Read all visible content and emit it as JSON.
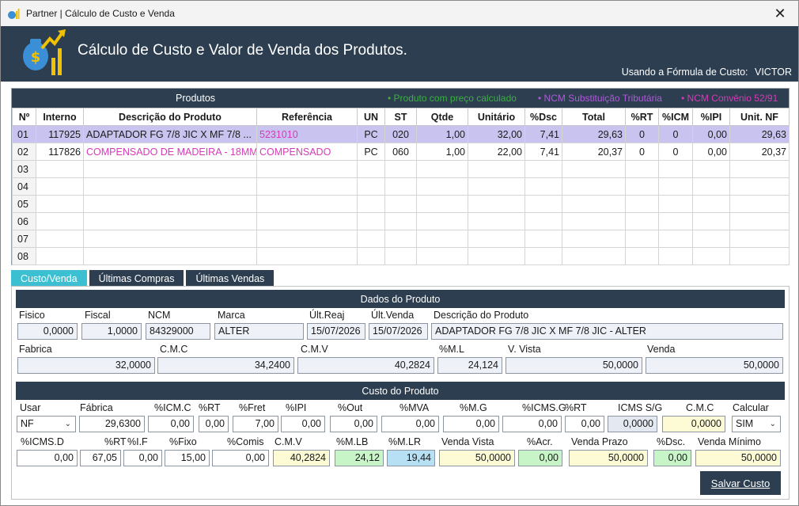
{
  "window": {
    "title": "Partner | Cálculo de Custo e Venda",
    "close": "✕"
  },
  "header": {
    "title": "Cálculo de Custo e Valor de Venda dos Produtos.",
    "formula_label": "Usando a Fórmula de Custo:",
    "formula_value": "VICTOR"
  },
  "products": {
    "label": "Produtos",
    "legend": [
      {
        "text": "• Produto com preço calculado",
        "color": "#3cb043"
      },
      {
        "text": "• NCM Substituição Tributária",
        "color": "#b05ad8"
      },
      {
        "text": "• NCM Convênio 52/91",
        "color": "#d63bb7"
      }
    ],
    "columns": [
      "Nº",
      "Interno",
      "Descrição do Produto",
      "Referência",
      "UN",
      "ST",
      "Qtde",
      "Unitário",
      "%Dsc",
      "Total",
      "%RT",
      "%ICM",
      "%IPI",
      "Unit. NF"
    ],
    "rows": [
      [
        "01",
        "117925",
        "ADAPTADOR FG 7/8 JIC X MF 7/8 ...",
        "5231010",
        "PC",
        "020",
        "1,00",
        "32,00",
        "7,41",
        "29,63",
        "0",
        "0",
        "0,00",
        "29,63"
      ],
      [
        "02",
        "117826",
        "COMPENSADO DE MADEIRA - 18MM",
        "COMPENSADO",
        "PC",
        "060",
        "1,00",
        "22,00",
        "7,41",
        "20,37",
        "0",
        "0",
        "0,00",
        "20,37"
      ],
      [
        "03",
        "",
        "",
        "",
        "",
        "",
        "",
        "",
        "",
        "",
        "",
        "",
        "",
        ""
      ],
      [
        "04",
        "",
        "",
        "",
        "",
        "",
        "",
        "",
        "",
        "",
        "",
        "",
        "",
        ""
      ],
      [
        "05",
        "",
        "",
        "",
        "",
        "",
        "",
        "",
        "",
        "",
        "",
        "",
        "",
        ""
      ],
      [
        "06",
        "",
        "",
        "",
        "",
        "",
        "",
        "",
        "",
        "",
        "",
        "",
        "",
        ""
      ],
      [
        "07",
        "",
        "",
        "",
        "",
        "",
        "",
        "",
        "",
        "",
        "",
        "",
        "",
        ""
      ],
      [
        "08",
        "",
        "",
        "",
        "",
        "",
        "",
        "",
        "",
        "",
        "",
        "",
        "",
        ""
      ]
    ]
  },
  "tabs": [
    "Custo/Venda",
    "Últimas Compras",
    "Últimas Vendas"
  ],
  "dados": {
    "title": "Dados do Produto",
    "labels": {
      "fisico": "Fisico",
      "fiscal": "Fiscal",
      "ncm": "NCM",
      "marca": "Marca",
      "ult_reaj": "Últ.Reaj",
      "ult_venda": "Últ.Venda",
      "descricao": "Descrição do Produto",
      "fabrica": "Fabrica",
      "cmc": "C.M.C",
      "cmv": "C.M.V",
      "ml": "%M.L",
      "vista": "V. Vista",
      "venda": "Venda"
    },
    "values": {
      "fisico": "0,0000",
      "fiscal": "1,0000",
      "ncm": "84329000",
      "marca": "ALTER",
      "ult_reaj": "15/07/2026",
      "ult_venda": "15/07/2026",
      "descricao": "ADAPTADOR FG 7/8 JIC X MF 7/8 JIC - ALTER",
      "fabrica": "32,0000",
      "cmc": "34,2400",
      "cmv": "40,2824",
      "ml": "24,124",
      "vista": "50,0000",
      "venda": "50,0000"
    }
  },
  "custo": {
    "title": "Custo do Produto",
    "row1_labels": [
      "Usar",
      "Fábrica",
      "%ICM.C",
      "%RT",
      "%Fret",
      "%IPI",
      "%Out",
      "%MVA",
      "%M.G",
      "%ICMS.G",
      "%RT",
      "ICMS S/G",
      "C.M.C",
      "Calcular"
    ],
    "row1_values": [
      "NF",
      "29,6300",
      "0,00",
      "0,00",
      "7,00",
      "0,00",
      "0,00",
      "0,00",
      "0,00",
      "0,00",
      "0,00",
      "0,0000",
      "0,0000",
      "SIM"
    ],
    "row2_labels": [
      "%ICMS.D",
      "%RT",
      "%I.F",
      "%Fixo",
      "%Comis",
      "C.M.V",
      "%M.LB",
      "%M.LR",
      "Venda Vista",
      "%Acr.",
      "Venda Prazo",
      "%Dsc.",
      "Venda Mínimo"
    ],
    "row2_values": [
      "0,00",
      "67,05",
      "0,00",
      "15,00",
      "0,00",
      "40,2824",
      "24,12",
      "19,44",
      "50,0000",
      "0,00",
      "50,0000",
      "0,00",
      "50,0000"
    ],
    "save_button": "Salvar Custo"
  },
  "colors": {
    "header": "#2c3e50",
    "tab_active": "#3cbfd0",
    "selected_row": "#c9c4ef",
    "ncm_52_91": "#d63bb7"
  }
}
